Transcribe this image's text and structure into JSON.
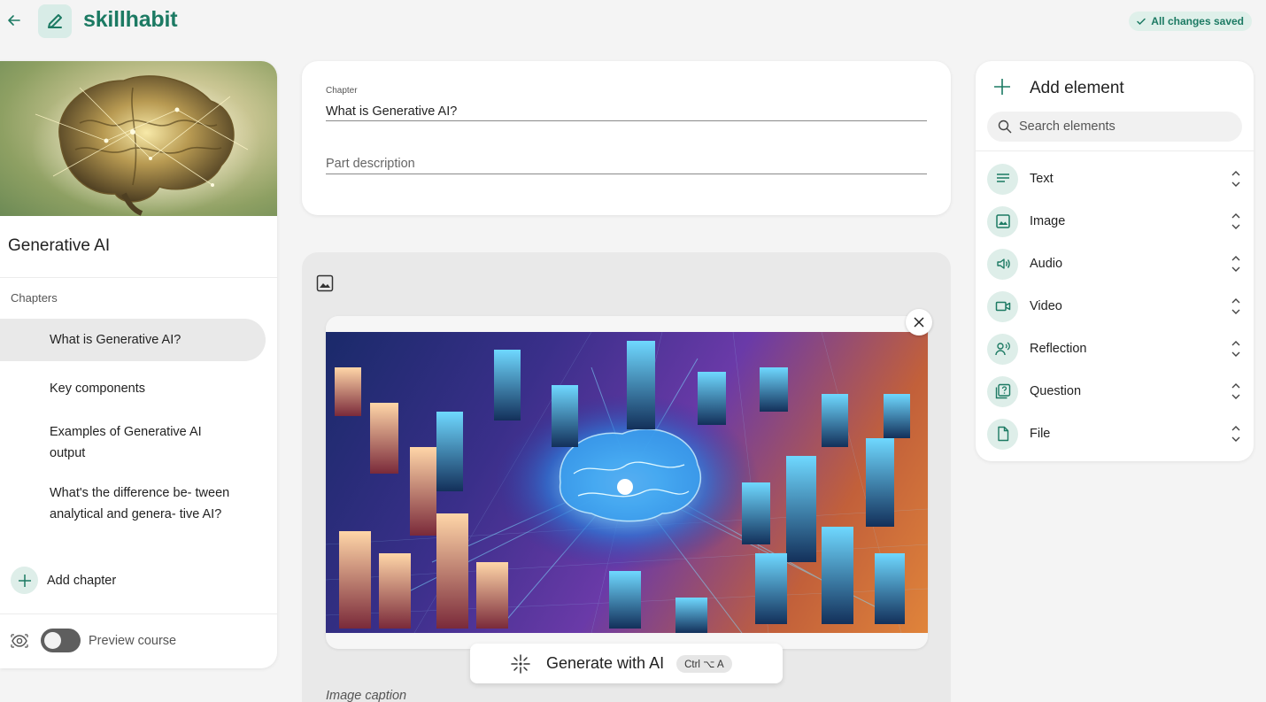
{
  "brand": {
    "name": "skillhabit",
    "accent": "#1c7a63"
  },
  "header": {
    "saved_status": "All changes saved"
  },
  "course": {
    "title": "Generative AI",
    "chapters_label": "Chapters",
    "chapters": [
      "What is Generative AI?",
      "Key components",
      "Examples of Generative AI output",
      "What's the difference be- tween analytical and genera- tive AI?"
    ],
    "add_chapter_label": "Add chapter",
    "preview_label": "Preview course"
  },
  "chapter_editor": {
    "field_label": "Chapter",
    "chapter_title": "What is Generative AI?",
    "description_placeholder": "Part description"
  },
  "image_block": {
    "caption_placeholder": "Image caption",
    "generate_label": "Generate with AI",
    "shortcut": "Ctrl ⌥ A"
  },
  "add_element": {
    "title": "Add element",
    "search_placeholder": "Search elements",
    "items": [
      {
        "label": "Text",
        "icon": "text-lines-icon"
      },
      {
        "label": "Image",
        "icon": "image-icon"
      },
      {
        "label": "Audio",
        "icon": "speaker-icon"
      },
      {
        "label": "Video",
        "icon": "video-camera-icon"
      },
      {
        "label": "Reflection",
        "icon": "reflection-icon"
      },
      {
        "label": "Question",
        "icon": "question-icon"
      },
      {
        "label": "File",
        "icon": "file-icon"
      }
    ]
  }
}
